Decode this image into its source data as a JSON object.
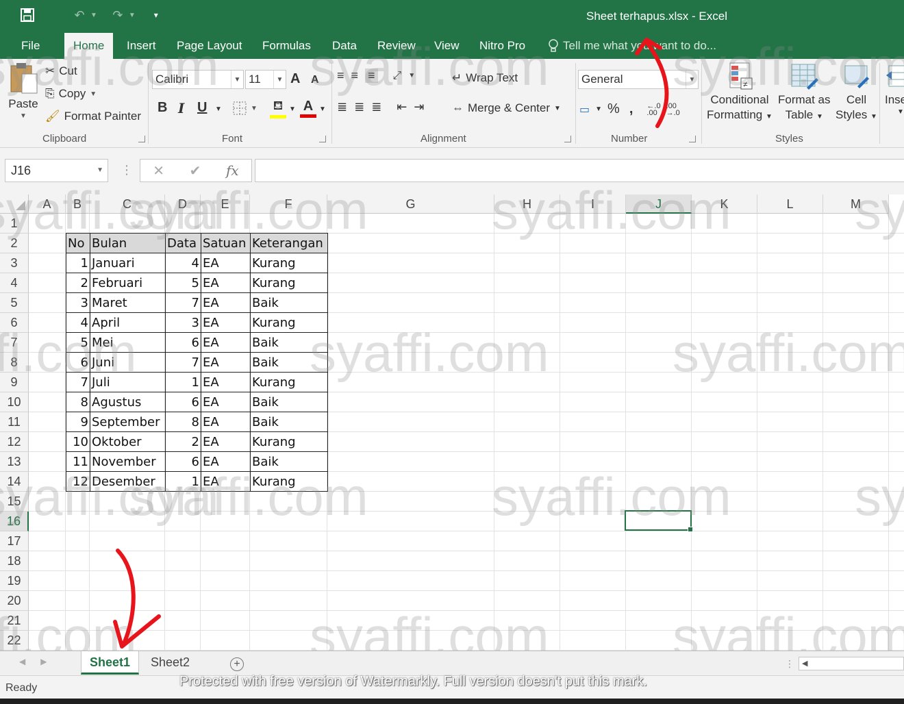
{
  "window": {
    "title": "Sheet terhapus.xlsx - Excel"
  },
  "tabs": [
    "File",
    "Home",
    "Insert",
    "Page Layout",
    "Formulas",
    "Data",
    "Review",
    "View",
    "Nitro Pro"
  ],
  "active_tab": "Home",
  "tell_me": "Tell me what you want to do...",
  "clipboard": {
    "paste": "Paste",
    "cut": "Cut",
    "copy": "Copy",
    "format_painter": "Format Painter",
    "label": "Clipboard"
  },
  "font": {
    "name": "Calibri",
    "size": "11",
    "label": "Font",
    "bold": "B",
    "italic": "I",
    "underline": "U",
    "grow": "A",
    "shrink": "A",
    "font_color": "A"
  },
  "alignment": {
    "wrap_text": "Wrap Text",
    "merge_center": "Merge & Center",
    "label": "Alignment"
  },
  "number": {
    "format": "General",
    "label": "Number",
    "percent": "%",
    "comma": ",",
    "inc_decimal": ".0\n.00",
    "dec_decimal": ".00\n.0"
  },
  "styles": {
    "conditional": "Conditional",
    "formatting": "Formatting",
    "format_as": "Format as",
    "table": "Table",
    "cell": "Cell",
    "cell_styles": "Styles",
    "label": "Styles"
  },
  "cells": {
    "insert": "Inse"
  },
  "formula_bar": {
    "name_box": "J16",
    "cancel": "✕",
    "enter": "✔",
    "fx": "fx",
    "value": ""
  },
  "columns": [
    "A",
    "B",
    "C",
    "D",
    "E",
    "F",
    "G",
    "H",
    "I",
    "J",
    "K",
    "L",
    "M"
  ],
  "rows": [
    "1",
    "2",
    "3",
    "4",
    "5",
    "6",
    "7",
    "8",
    "9",
    "10",
    "11",
    "12",
    "13",
    "14",
    "15",
    "16",
    "17",
    "18",
    "19",
    "20",
    "21",
    "22"
  ],
  "selected": {
    "column": "J",
    "row": "16"
  },
  "table": {
    "headers": [
      "No",
      "Bulan",
      "Data",
      "Satuan",
      "Keterangan"
    ],
    "rows": [
      [
        "1",
        "Januari",
        "4",
        "EA",
        "Kurang"
      ],
      [
        "2",
        "Februari",
        "5",
        "EA",
        "Kurang"
      ],
      [
        "3",
        "Maret",
        "7",
        "EA",
        "Baik"
      ],
      [
        "4",
        "April",
        "3",
        "EA",
        "Kurang"
      ],
      [
        "5",
        "Mei",
        "6",
        "EA",
        "Baik"
      ],
      [
        "6",
        "Juni",
        "7",
        "EA",
        "Baik"
      ],
      [
        "7",
        "Juli",
        "1",
        "EA",
        "Kurang"
      ],
      [
        "8",
        "Agustus",
        "6",
        "EA",
        "Baik"
      ],
      [
        "9",
        "September",
        "8",
        "EA",
        "Baik"
      ],
      [
        "10",
        "Oktober",
        "2",
        "EA",
        "Kurang"
      ],
      [
        "11",
        "November",
        "6",
        "EA",
        "Baik"
      ],
      [
        "12",
        "Desember",
        "1",
        "EA",
        "Kurang"
      ]
    ]
  },
  "sheets": [
    "Sheet1",
    "Sheet2"
  ],
  "active_sheet": "Sheet1",
  "status": {
    "ready": "Ready",
    "notice": "Protected with free version of Watermarkly. Full version doesn't put this mark."
  },
  "watermark": "syaffi.com",
  "colors": {
    "excel_green": "#227447",
    "accent": "#217346",
    "arrow_red": "#e8141b"
  }
}
